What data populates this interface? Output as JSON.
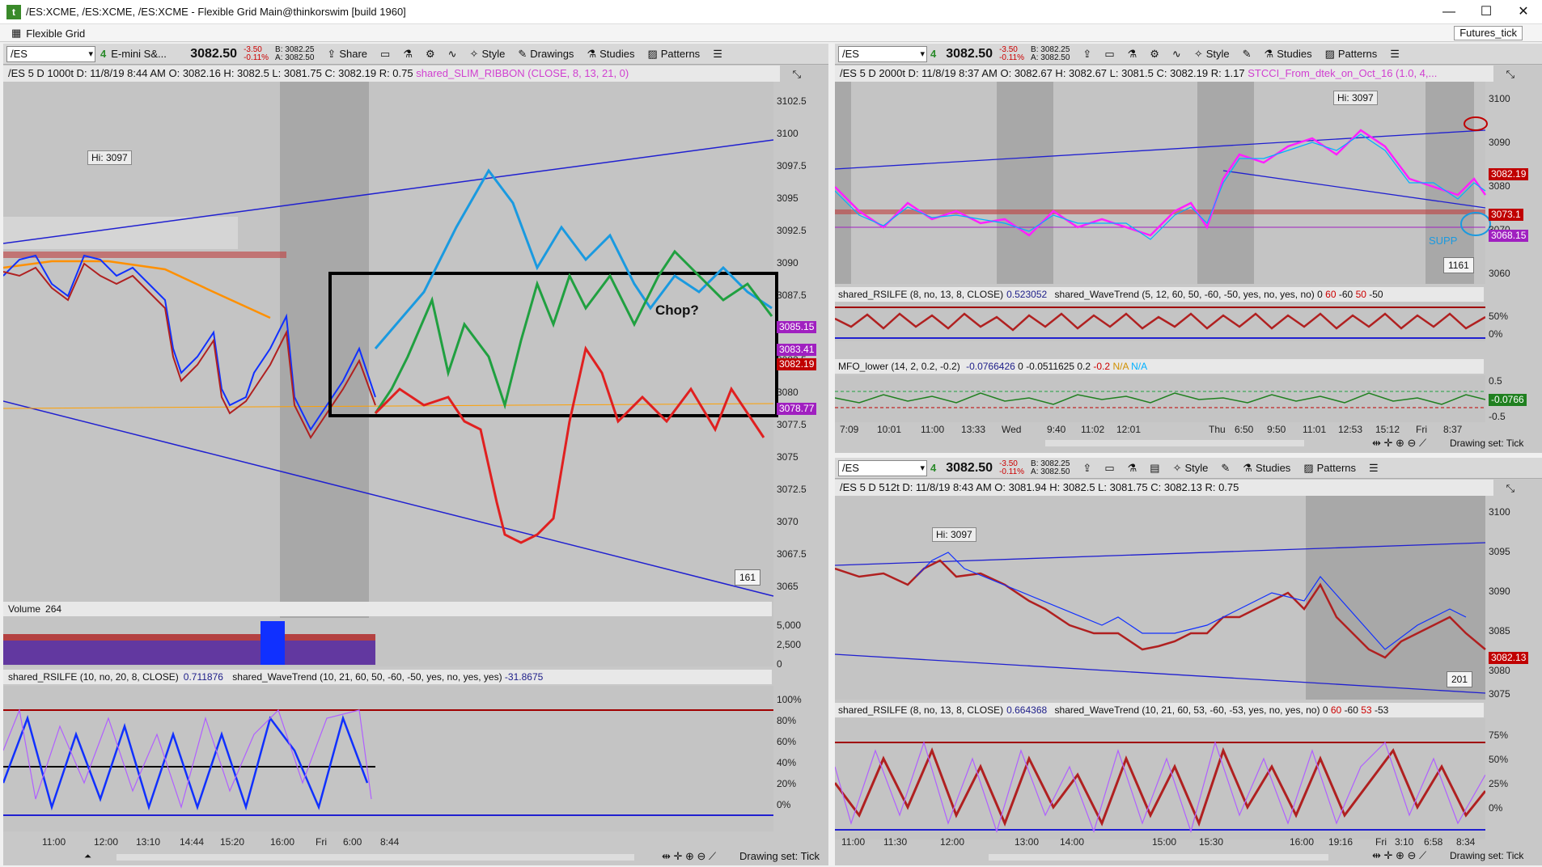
{
  "window": {
    "title": "/ES:XCME, /ES:XCME, /ES:XCME - Flexible Grid Main@thinkorswim [build 1960]",
    "grid_tab": "Flexible Grid",
    "layout_tab": "Futures_tick"
  },
  "colors": {
    "blue": "#2020d0",
    "orange": "#ffa000",
    "purple": "#a020c0",
    "red": "#c00000",
    "green": "#20a040",
    "cyan": "#00b0ff",
    "magenta": "#ff20ff"
  },
  "left": {
    "symbol": "/ES",
    "desc": "E-mini S&...",
    "price": "3082.50",
    "change": "-3.50",
    "change_pct": "-0.11%",
    "bid": "B: 3082.25",
    "ask": "A: 3082.50",
    "buttons": {
      "share": "Share",
      "style": "Style",
      "drawings": "Drawings",
      "studies": "Studies",
      "patterns": "Patterns"
    },
    "info": "/ES 5 D 1000t  D: 11/8/19 8:44 AM  O: 3082.16  H: 3082.5  L: 3081.75  C: 3082.19  R: 0.75",
    "study_label": "shared_SLIM_RIBBON (CLOSE, 8, 13, 21, 0)",
    "y_ticks": [
      "3102.5",
      "3100",
      "3097.5",
      "3095",
      "3092.5",
      "3090",
      "3087.5",
      "3085",
      "3082.5",
      "3080",
      "3077.5",
      "3075",
      "3072.5",
      "3070",
      "3067.5",
      "3065"
    ],
    "tags": {
      "t1": "3085.15",
      "t2": "3083.41",
      "t3": "3082.19",
      "t4": "3078.77"
    },
    "hi": "Hi: 3097",
    "count": "161",
    "annotation": "Chop?",
    "volume_label": "Volume",
    "volume_value": "264",
    "vol_ticks": [
      "5,000",
      "2,500",
      "0"
    ],
    "osc_header": "shared_RSILFE (10, no, 20, 8, CLOSE)",
    "osc_val": "0.711876",
    "osc_header2": "shared_WaveTrend (10, 21, 60, 50, -60, -50, yes, no, yes, yes)",
    "osc_val2": "-31.8675",
    "osc_ticks": [
      "100%",
      "80%",
      "60%",
      "40%",
      "20%",
      "0%"
    ],
    "times": [
      "11:00",
      "12:00",
      "13:10",
      "14:44",
      "15:20",
      "16:00",
      "Fri",
      "6:00",
      "8:44"
    ],
    "drawing_set": "Drawing set: Tick"
  },
  "rt": {
    "symbol": "/ES",
    "price": "3082.50",
    "change": "-3.50",
    "change_pct": "-0.11%",
    "bid": "B: 3082.25",
    "ask": "A: 3082.50",
    "buttons": {
      "style": "Style",
      "studies": "Studies",
      "patterns": "Patterns"
    },
    "info": "/ES 5 D 2000t  D: 11/8/19 8:37 AM  O: 3082.67  H: 3082.67  L: 3081.5  C: 3082.19  R: 1.17",
    "study_label": "STCCI_From_dtek_on_Oct_16 (1.0, 4,...",
    "y_ticks": [
      "3100",
      "3090",
      "3080",
      "3070",
      "3060"
    ],
    "tags": {
      "t1": "3082.19",
      "t2": "3073.1",
      "t3": "3068.15"
    },
    "hi": "Hi: 3097",
    "count": "1161",
    "supp": "SUPP",
    "osc_header": "shared_RSILFE (8, no, 13, 8, CLOSE)",
    "osc_val": "0.523052",
    "osc_header2": "shared_WaveTrend (5, 12, 60, 50, -60, -50, yes, no, yes, no)",
    "osc_nums": [
      "0",
      "60",
      "-60",
      "50",
      "-50"
    ],
    "osc_ticks": [
      "50%",
      "0%"
    ],
    "mfo_header": "MFO_lower (14, 2, 0.2, -0.2)",
    "mfo_vals": [
      "-0.0766426",
      "0",
      "-0.0511625",
      "0.2",
      "-0.2",
      "N/A",
      "N/A"
    ],
    "mfo_ticks": [
      "0.5",
      "-0.5"
    ],
    "mfo_tag": "-0.0766",
    "times": [
      "7:09",
      "10:01",
      "11:00",
      "13:33",
      "Wed",
      "9:40",
      "11:02",
      "12:01",
      "Thu",
      "6:50",
      "9:50",
      "11:01",
      "12:53",
      "15:12",
      "Fri",
      "8:37"
    ],
    "drawing_set": "Drawing set: Tick"
  },
  "rb": {
    "symbol": "/ES",
    "price": "3082.50",
    "change": "-3.50",
    "change_pct": "-0.11%",
    "bid": "B: 3082.25",
    "ask": "A: 3082.50",
    "buttons": {
      "style": "Style",
      "studies": "Studies",
      "patterns": "Patterns"
    },
    "info": "/ES 5 D 512t  D: 11/8/19 8:43 AM  O: 3081.94  H: 3082.5  L: 3081.75  C: 3082.13  R: 0.75",
    "y_ticks": [
      "3100",
      "3095",
      "3090",
      "3085",
      "3080",
      "3075"
    ],
    "tags": {
      "t1": "3082.13"
    },
    "hi": "Hi: 3097",
    "count": "201",
    "osc_header": "shared_RSILFE (8, no, 13, 8, CLOSE)",
    "osc_val": "0.664368",
    "osc_header2": "shared_WaveTrend (10, 21, 60, 53, -60, -53, yes, no, yes, no)",
    "osc_nums": [
      "0",
      "60",
      "-60",
      "53",
      "-53"
    ],
    "osc_ticks": [
      "75%",
      "50%",
      "25%",
      "0%"
    ],
    "times": [
      "11:00",
      "11:30",
      "12:00",
      "13:00",
      "14:00",
      "15:00",
      "15:30",
      "16:00",
      "19:16",
      "Fri",
      "3:10",
      "6:58",
      "8:34"
    ],
    "drawing_set": "Drawing set: Tick"
  }
}
